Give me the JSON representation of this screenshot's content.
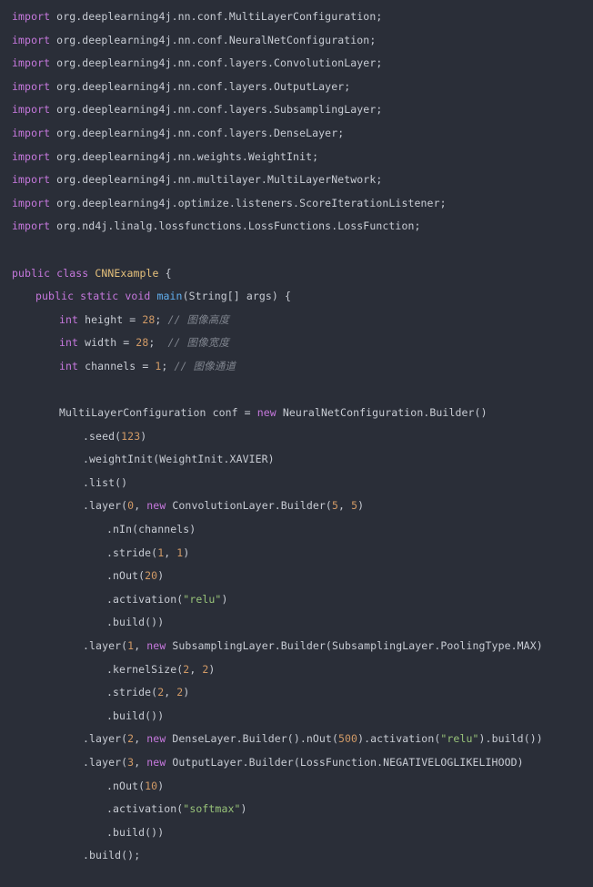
{
  "editor": {
    "language": "java",
    "theme_name": "one-dark",
    "background_color": "#2a2e38",
    "default_text_color": "#c8ccd4",
    "colors": {
      "keyword": "#c678dd",
      "class_name": "#e5c07b",
      "function_name": "#61afef",
      "number": "#d19a66",
      "string": "#98c379",
      "comment": "#7f848e",
      "punctuation": "#abb2bf"
    }
  },
  "code": {
    "lines": [
      {
        "indent": 0,
        "tokens": [
          {
            "t": "import",
            "c": "kw"
          },
          {
            "t": " org.deeplearning4j.nn.conf.MultiLayerConfiguration;",
            "c": "plain"
          }
        ]
      },
      {
        "indent": 0,
        "tokens": [
          {
            "t": "import",
            "c": "kw"
          },
          {
            "t": " org.deeplearning4j.nn.conf.NeuralNetConfiguration;",
            "c": "plain"
          }
        ]
      },
      {
        "indent": 0,
        "tokens": [
          {
            "t": "import",
            "c": "kw"
          },
          {
            "t": " org.deeplearning4j.nn.conf.layers.ConvolutionLayer;",
            "c": "plain"
          }
        ]
      },
      {
        "indent": 0,
        "tokens": [
          {
            "t": "import",
            "c": "kw"
          },
          {
            "t": " org.deeplearning4j.nn.conf.layers.OutputLayer;",
            "c": "plain"
          }
        ]
      },
      {
        "indent": 0,
        "tokens": [
          {
            "t": "import",
            "c": "kw"
          },
          {
            "t": " org.deeplearning4j.nn.conf.layers.SubsamplingLayer;",
            "c": "plain"
          }
        ]
      },
      {
        "indent": 0,
        "tokens": [
          {
            "t": "import",
            "c": "kw"
          },
          {
            "t": " org.deeplearning4j.nn.conf.layers.DenseLayer;",
            "c": "plain"
          }
        ]
      },
      {
        "indent": 0,
        "tokens": [
          {
            "t": "import",
            "c": "kw"
          },
          {
            "t": " org.deeplearning4j.nn.weights.WeightInit;",
            "c": "plain"
          }
        ]
      },
      {
        "indent": 0,
        "tokens": [
          {
            "t": "import",
            "c": "kw"
          },
          {
            "t": " org.deeplearning4j.nn.multilayer.MultiLayerNetwork;",
            "c": "plain"
          }
        ]
      },
      {
        "indent": 0,
        "tokens": [
          {
            "t": "import",
            "c": "kw"
          },
          {
            "t": " org.deeplearning4j.optimize.listeners.ScoreIterationListener;",
            "c": "plain"
          }
        ]
      },
      {
        "indent": 0,
        "tokens": [
          {
            "t": "import",
            "c": "kw"
          },
          {
            "t": " org.nd4j.linalg.lossfunctions.LossFunctions.LossFunction;",
            "c": "plain"
          }
        ]
      },
      {
        "indent": 0,
        "tokens": []
      },
      {
        "indent": 0,
        "tokens": [
          {
            "t": "public class",
            "c": "kw"
          },
          {
            "t": " ",
            "c": "plain"
          },
          {
            "t": "CNNExample",
            "c": "cls"
          },
          {
            "t": " {",
            "c": "plain"
          }
        ]
      },
      {
        "indent": 1,
        "tokens": [
          {
            "t": "public static void",
            "c": "kw"
          },
          {
            "t": " ",
            "c": "plain"
          },
          {
            "t": "main",
            "c": "fn"
          },
          {
            "t": "(String[] args) {",
            "c": "plain"
          }
        ]
      },
      {
        "indent": 2,
        "tokens": [
          {
            "t": "int",
            "c": "kw"
          },
          {
            "t": " height = ",
            "c": "plain"
          },
          {
            "t": "28",
            "c": "num"
          },
          {
            "t": "; ",
            "c": "plain"
          },
          {
            "t": "// ",
            "c": "cmt"
          },
          {
            "t": "图像高度",
            "c": "cjk"
          }
        ]
      },
      {
        "indent": 2,
        "tokens": [
          {
            "t": "int",
            "c": "kw"
          },
          {
            "t": " width = ",
            "c": "plain"
          },
          {
            "t": "28",
            "c": "num"
          },
          {
            "t": ";  ",
            "c": "plain"
          },
          {
            "t": "// ",
            "c": "cmt"
          },
          {
            "t": "图像宽度",
            "c": "cjk"
          }
        ]
      },
      {
        "indent": 2,
        "tokens": [
          {
            "t": "int",
            "c": "kw"
          },
          {
            "t": " channels = ",
            "c": "plain"
          },
          {
            "t": "1",
            "c": "num"
          },
          {
            "t": "; ",
            "c": "plain"
          },
          {
            "t": "// ",
            "c": "cmt"
          },
          {
            "t": "图像通道",
            "c": "cjk"
          }
        ]
      },
      {
        "indent": 0,
        "tokens": []
      },
      {
        "indent": 2,
        "tokens": [
          {
            "t": "MultiLayerConfiguration conf = ",
            "c": "plain"
          },
          {
            "t": "new",
            "c": "kw"
          },
          {
            "t": " NeuralNetConfiguration.Builder()",
            "c": "plain"
          }
        ]
      },
      {
        "indent": 3,
        "tokens": [
          {
            "t": ".seed(",
            "c": "plain"
          },
          {
            "t": "123",
            "c": "num"
          },
          {
            "t": ")",
            "c": "plain"
          }
        ]
      },
      {
        "indent": 3,
        "tokens": [
          {
            "t": ".weightInit(WeightInit.XAVIER)",
            "c": "plain"
          }
        ]
      },
      {
        "indent": 3,
        "tokens": [
          {
            "t": ".list()",
            "c": "plain"
          }
        ]
      },
      {
        "indent": 3,
        "tokens": [
          {
            "t": ".layer(",
            "c": "plain"
          },
          {
            "t": "0",
            "c": "num"
          },
          {
            "t": ", ",
            "c": "plain"
          },
          {
            "t": "new",
            "c": "kw"
          },
          {
            "t": " ConvolutionLayer.Builder(",
            "c": "plain"
          },
          {
            "t": "5",
            "c": "num"
          },
          {
            "t": ", ",
            "c": "plain"
          },
          {
            "t": "5",
            "c": "num"
          },
          {
            "t": ")",
            "c": "plain"
          }
        ]
      },
      {
        "indent": 4,
        "tokens": [
          {
            "t": ".nIn(channels)",
            "c": "plain"
          }
        ]
      },
      {
        "indent": 4,
        "tokens": [
          {
            "t": ".stride(",
            "c": "plain"
          },
          {
            "t": "1",
            "c": "num"
          },
          {
            "t": ", ",
            "c": "plain"
          },
          {
            "t": "1",
            "c": "num"
          },
          {
            "t": ")",
            "c": "plain"
          }
        ]
      },
      {
        "indent": 4,
        "tokens": [
          {
            "t": ".nOut(",
            "c": "plain"
          },
          {
            "t": "20",
            "c": "num"
          },
          {
            "t": ")",
            "c": "plain"
          }
        ]
      },
      {
        "indent": 4,
        "tokens": [
          {
            "t": ".activation(",
            "c": "plain"
          },
          {
            "t": "\"relu\"",
            "c": "str"
          },
          {
            "t": ")",
            "c": "plain"
          }
        ]
      },
      {
        "indent": 4,
        "tokens": [
          {
            "t": ".build())",
            "c": "plain"
          }
        ]
      },
      {
        "indent": 3,
        "tokens": [
          {
            "t": ".layer(",
            "c": "plain"
          },
          {
            "t": "1",
            "c": "num"
          },
          {
            "t": ", ",
            "c": "plain"
          },
          {
            "t": "new",
            "c": "kw"
          },
          {
            "t": " SubsamplingLayer.Builder(SubsamplingLayer.PoolingType.MAX)",
            "c": "plain"
          }
        ]
      },
      {
        "indent": 4,
        "tokens": [
          {
            "t": ".kernelSize(",
            "c": "plain"
          },
          {
            "t": "2",
            "c": "num"
          },
          {
            "t": ", ",
            "c": "plain"
          },
          {
            "t": "2",
            "c": "num"
          },
          {
            "t": ")",
            "c": "plain"
          }
        ]
      },
      {
        "indent": 4,
        "tokens": [
          {
            "t": ".stride(",
            "c": "plain"
          },
          {
            "t": "2",
            "c": "num"
          },
          {
            "t": ", ",
            "c": "plain"
          },
          {
            "t": "2",
            "c": "num"
          },
          {
            "t": ")",
            "c": "plain"
          }
        ]
      },
      {
        "indent": 4,
        "tokens": [
          {
            "t": ".build())",
            "c": "plain"
          }
        ]
      },
      {
        "indent": 3,
        "tokens": [
          {
            "t": ".layer(",
            "c": "plain"
          },
          {
            "t": "2",
            "c": "num"
          },
          {
            "t": ", ",
            "c": "plain"
          },
          {
            "t": "new",
            "c": "kw"
          },
          {
            "t": " DenseLayer.Builder().nOut(",
            "c": "plain"
          },
          {
            "t": "500",
            "c": "num"
          },
          {
            "t": ").activation(",
            "c": "plain"
          },
          {
            "t": "\"relu\"",
            "c": "str"
          },
          {
            "t": ").build())",
            "c": "plain"
          }
        ]
      },
      {
        "indent": 3,
        "tokens": [
          {
            "t": ".layer(",
            "c": "plain"
          },
          {
            "t": "3",
            "c": "num"
          },
          {
            "t": ", ",
            "c": "plain"
          },
          {
            "t": "new",
            "c": "kw"
          },
          {
            "t": " OutputLayer.Builder(LossFunction.NEGATIVELOGLIKELIHOOD)",
            "c": "plain"
          }
        ]
      },
      {
        "indent": 4,
        "tokens": [
          {
            "t": ".nOut(",
            "c": "plain"
          },
          {
            "t": "10",
            "c": "num"
          },
          {
            "t": ")",
            "c": "plain"
          }
        ]
      },
      {
        "indent": 4,
        "tokens": [
          {
            "t": ".activation(",
            "c": "plain"
          },
          {
            "t": "\"softmax\"",
            "c": "str"
          },
          {
            "t": ")",
            "c": "plain"
          }
        ]
      },
      {
        "indent": 4,
        "tokens": [
          {
            "t": ".build())",
            "c": "plain"
          }
        ]
      },
      {
        "indent": 3,
        "tokens": [
          {
            "t": ".build();",
            "c": "plain"
          }
        ]
      }
    ]
  }
}
